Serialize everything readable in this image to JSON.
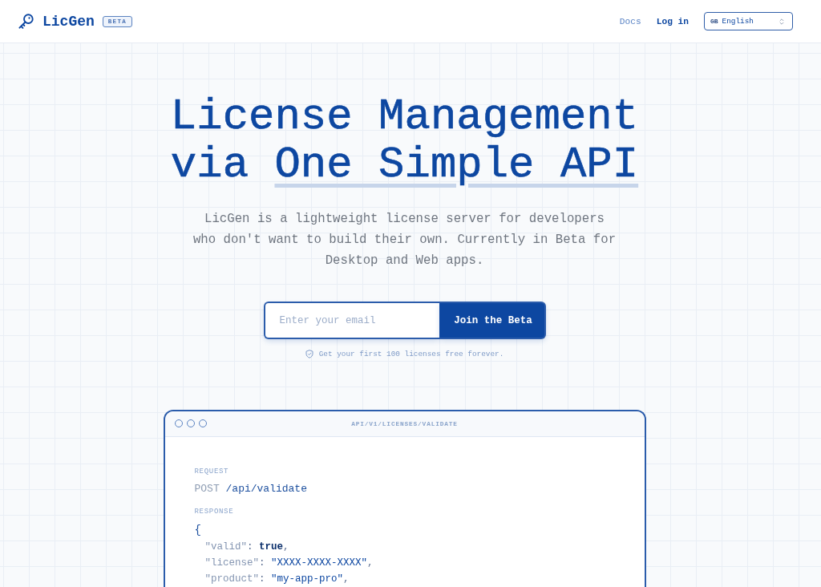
{
  "header": {
    "logo": "LicGen",
    "badge": "BETA",
    "nav": [
      {
        "label": "Docs",
        "kind": "link"
      },
      {
        "label": "Log in",
        "kind": "strong"
      }
    ],
    "language": {
      "flag": "GB",
      "label": "English"
    }
  },
  "hero": {
    "title": "License Management via",
    "highlight": "One Simple API",
    "subtitle": "LicGen is a lightweight license server for developers who don't want to build their own. Currently in Beta for Desktop and Web apps.",
    "email": {
      "placeholder": "Enter your email"
    },
    "cta": "Join the Beta",
    "note": "Get your first 100 licenses free forever."
  },
  "code_window": {
    "title": "API/V1/LICENSES/VALIDATE",
    "request_label": "REQUEST",
    "request": {
      "method": "POST",
      "path": "/api/validate"
    },
    "response_label": "RESPONSE",
    "response_lines": [
      {
        "tokens": [
          {
            "kind": "punct",
            "text": "{"
          }
        ],
        "children": [
          {
            "tokens": [
              {
                "kind": "key",
                "text": "\"valid\""
              },
              {
                "kind": "sep",
                "text": ": "
              },
              {
                "kind": "bool",
                "text": "true"
              },
              {
                "kind": "sep",
                "text": ","
              }
            ]
          },
          {
            "tokens": [
              {
                "kind": "key",
                "text": "\"license\""
              },
              {
                "kind": "sep",
                "text": ": "
              },
              {
                "kind": "string",
                "text": "\"XXXX-XXXX-XXXX\""
              },
              {
                "kind": "sep",
                "text": ","
              }
            ]
          },
          {
            "tokens": [
              {
                "kind": "key",
                "text": "\"product\""
              },
              {
                "kind": "sep",
                "text": ": "
              },
              {
                "kind": "string",
                "text": "\"my-app-pro\""
              },
              {
                "kind": "sep",
                "text": ","
              }
            ]
          }
        ]
      }
    ]
  }
}
